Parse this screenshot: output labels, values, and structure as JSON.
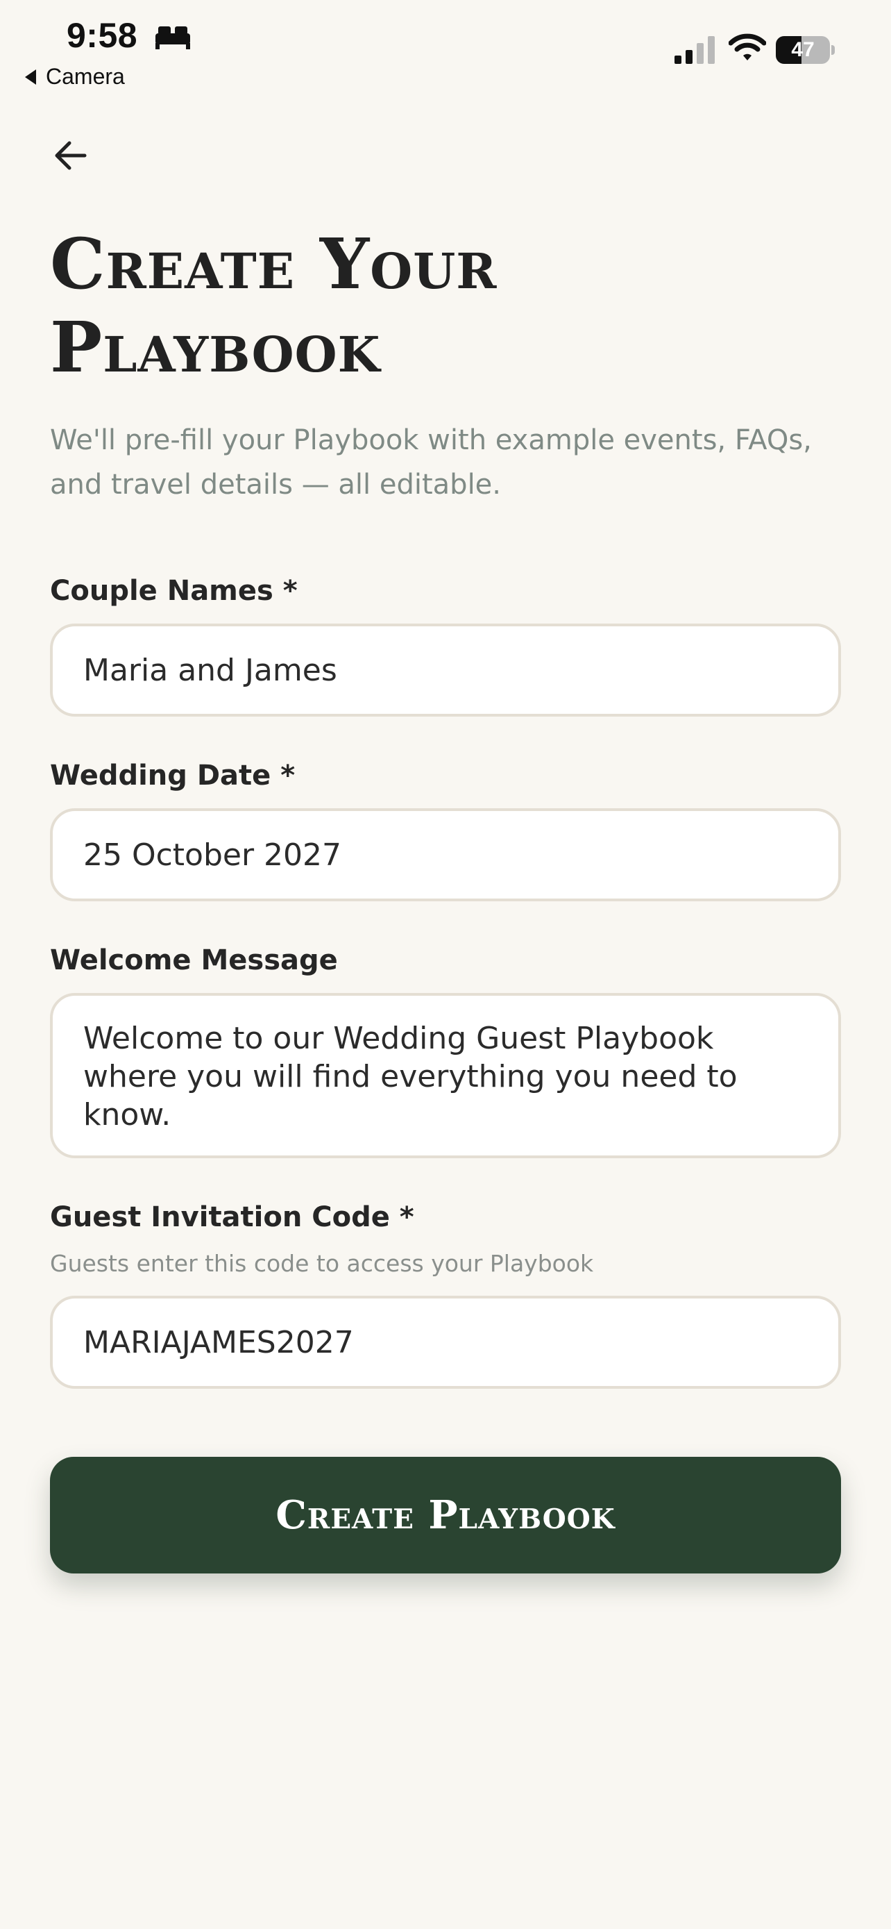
{
  "status_bar": {
    "time": "9:58",
    "back_app": "Camera",
    "battery_level": "47",
    "battery_fraction": 0.47
  },
  "icons": {
    "bed": "bed-icon",
    "signal": "cellular-signal-icon",
    "wifi": "wifi-icon",
    "back": "arrow-left-icon"
  },
  "page": {
    "title_line1": "Create Your",
    "title_line2": "Playbook",
    "subtitle": "We'll pre-fill your Playbook with example events, FAQs, and travel details — all editable."
  },
  "form": {
    "couple_names": {
      "label": "Couple Names *",
      "value": "Maria and James"
    },
    "wedding_date": {
      "label": "Wedding Date *",
      "value": "25 October 2027"
    },
    "welcome_message": {
      "label": "Welcome Message",
      "value": "Welcome to our Wedding Guest Playbook where you will find everything you need to know."
    },
    "invitation_code": {
      "label": "Guest Invitation Code *",
      "hint": "Guests enter this code to access your Playbook",
      "value": "MARIAJAMES2027"
    }
  },
  "actions": {
    "create_label": "Create Playbook"
  },
  "colors": {
    "background": "#f9f7f2",
    "primary_button": "#2a4431",
    "field_border": "#e4ded3",
    "muted_text": "#7f8a85"
  }
}
